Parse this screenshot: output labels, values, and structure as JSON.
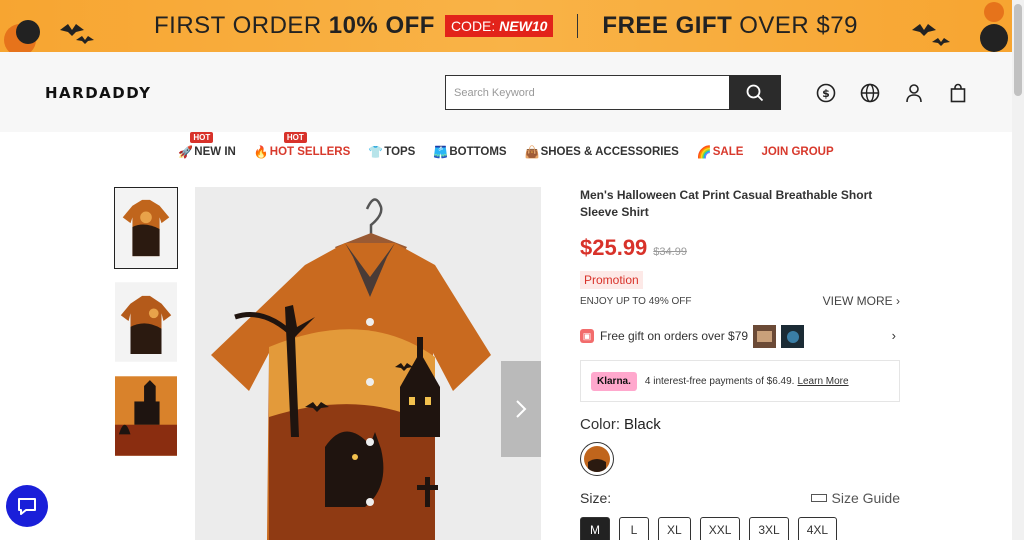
{
  "banner": {
    "first_order": "FIRST ORDER",
    "discount": "10% OFF",
    "code_label": "CODE:",
    "code_value": "NEW10",
    "free_gift": "FREE GIFT",
    "over": "OVER $79",
    "bg_color": "#f7a531"
  },
  "header": {
    "logo": "HARDADDY",
    "search_placeholder": "Search Keyword",
    "icons": [
      "search-icon",
      "currency-icon",
      "globe-icon",
      "user-icon",
      "bag-icon"
    ]
  },
  "nav": {
    "items": [
      {
        "label": "NEW IN",
        "icon": "🚀",
        "hot": "HOT"
      },
      {
        "label": "HOT SELLERS",
        "icon": "🔥",
        "hot": "HOT"
      },
      {
        "label": "TOPS",
        "icon": "👕"
      },
      {
        "label": "BOTTOMS",
        "icon": "🩳"
      },
      {
        "label": "SHOES & ACCESSORIES",
        "icon": "👜"
      },
      {
        "label": "SALE",
        "icon": "🌈"
      },
      {
        "label": "JOIN GROUP"
      }
    ]
  },
  "product": {
    "title": "Men's Halloween Cat Print Casual Breathable Short Sleeve Shirt",
    "price": "$25.99",
    "old_price": "$34.99",
    "promotion": "Promotion",
    "enjoy": "ENJOY UP TO 49% OFF",
    "view_more": "VIEW MORE",
    "gift": "Free gift on orders over $79",
    "klarna_badge": "Klarna.",
    "klarna_text": "4 interest-free payments of $6.49.",
    "klarna_learn": "Learn More",
    "color_label": "Color:",
    "color_value": "Black",
    "size_label": "Size:",
    "size_guide": "Size Guide",
    "sizes": [
      "M",
      "L",
      "XL",
      "XXL",
      "3XL",
      "4XL"
    ],
    "selected_size": "M",
    "price_color": "#d8322a"
  }
}
